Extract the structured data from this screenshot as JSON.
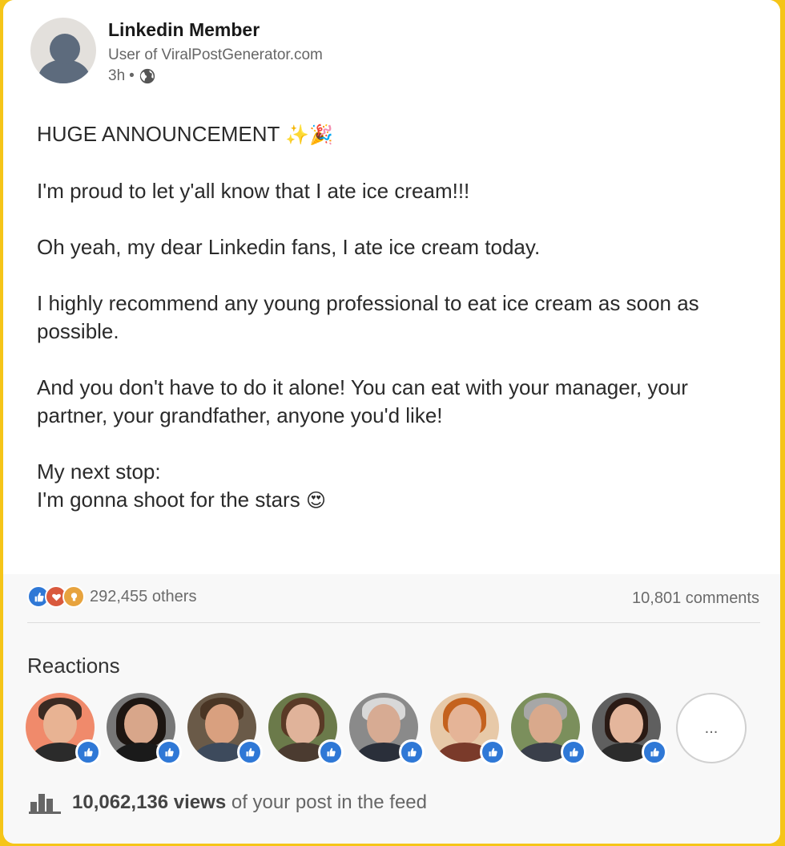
{
  "post": {
    "author_name": "Linkedin Member",
    "author_subtitle": "User of ViralPostGenerator.com",
    "time": "3h",
    "separator": "•",
    "lines": [
      {
        "text": "HUGE ANNOUNCEMENT",
        "emoji": "✨🎉"
      },
      {
        "text": "I'm proud to let y'all know that I ate ice cream!!!"
      },
      {
        "text": "Oh yeah, my dear Linkedin fans, I ate ice cream today."
      },
      {
        "text": "I highly recommend any young professional to eat ice cream as soon as possible."
      },
      {
        "text": "And you don't have to do it alone! You can eat with your manager, your partner, your grandfather, anyone you'd like!"
      },
      {
        "text": "My next stop:"
      },
      {
        "text": "I'm gonna shoot for the stars",
        "emoji": "😍"
      }
    ]
  },
  "social": {
    "reaction_icons": [
      "like-reaction-icon",
      "love-reaction-icon",
      "insightful-reaction-icon"
    ],
    "others": "292,455 others",
    "comments": "10,801 comments"
  },
  "reactions": {
    "title": "Reactions",
    "people_count": 8,
    "more_label": "...",
    "colors": {
      "like": "#2f78d6",
      "love": "#d9593d",
      "insightful": "#e7a33e"
    }
  },
  "views": {
    "count": "10,062,136 views",
    "suffix": "of your post in the feed"
  }
}
